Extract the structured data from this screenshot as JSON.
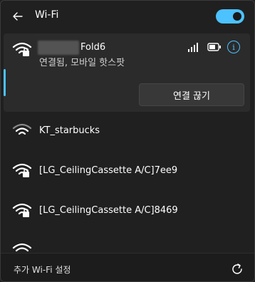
{
  "header": {
    "title": "Wi-Fi",
    "back_icon": "back-arrow-icon",
    "toggle_on": true,
    "accent": "#4cc2ff"
  },
  "active_network": {
    "name_suffix": "Fold6",
    "status": "연결됨, 모바일 핫스팟",
    "disconnect_label": "연결 끊기",
    "icons": [
      "wifi-locked-icon",
      "signal-bars-icon",
      "battery-icon",
      "info-icon"
    ]
  },
  "networks": [
    {
      "name": "KT_starbucks",
      "secured": false
    },
    {
      "name": "[LG_CeilingCassette A/C]7ee9",
      "secured": true
    },
    {
      "name": "[LG_CeilingCassette A/C]8469",
      "secured": true
    },
    {
      "name": "",
      "secured": true
    }
  ],
  "footer": {
    "label": "추가 Wi-Fi 설정",
    "refresh_icon": "refresh-icon"
  }
}
